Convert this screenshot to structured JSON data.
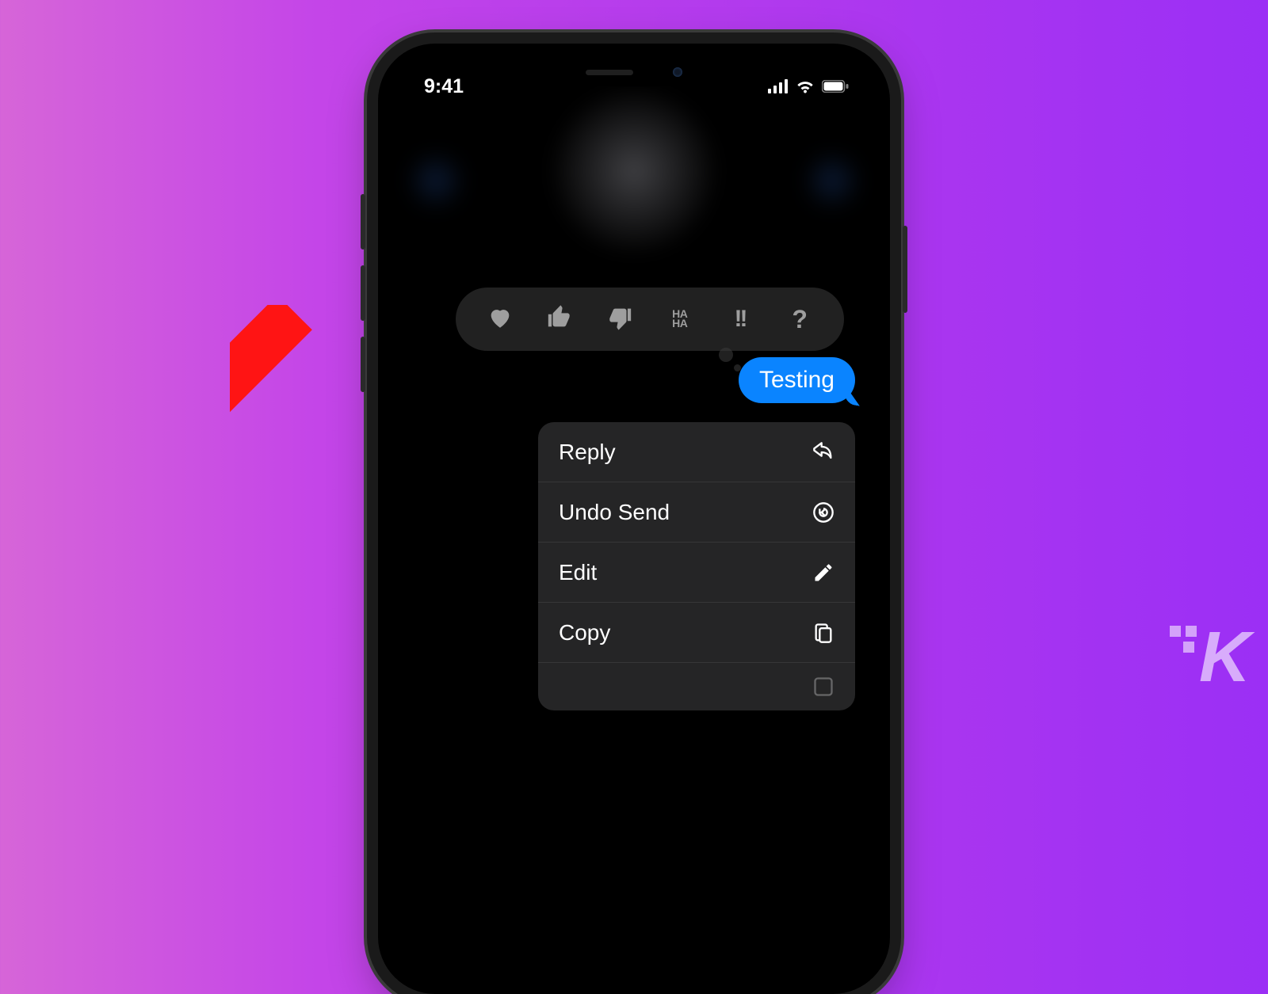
{
  "status": {
    "time": "9:41",
    "signal_icon": "cellular-signal-icon",
    "wifi_icon": "wifi-icon",
    "battery_icon": "battery-icon"
  },
  "tapback": {
    "heart": "heart-icon",
    "thumbs_up": "thumbs-up-icon",
    "thumbs_down": "thumbs-down-icon",
    "haha_top": "HA",
    "haha_bottom": "HA",
    "emphasis": "!!",
    "question": "?"
  },
  "message": {
    "text": "Testing"
  },
  "menu": {
    "items": [
      {
        "label": "Reply",
        "icon": "reply-arrow-icon"
      },
      {
        "label": "Undo Send",
        "icon": "undo-circle-icon"
      },
      {
        "label": "Edit",
        "icon": "pencil-icon"
      },
      {
        "label": "Copy",
        "icon": "doc-on-doc-icon"
      },
      {
        "label": "",
        "icon": "translate-icon"
      }
    ]
  },
  "watermark": {
    "letter": "K"
  },
  "colors": {
    "bubble_blue": "#0a84ff",
    "annotation_red": "#ff0000",
    "bg_gradient_start": "#d665d8",
    "bg_gradient_end": "#9b2ff5"
  }
}
